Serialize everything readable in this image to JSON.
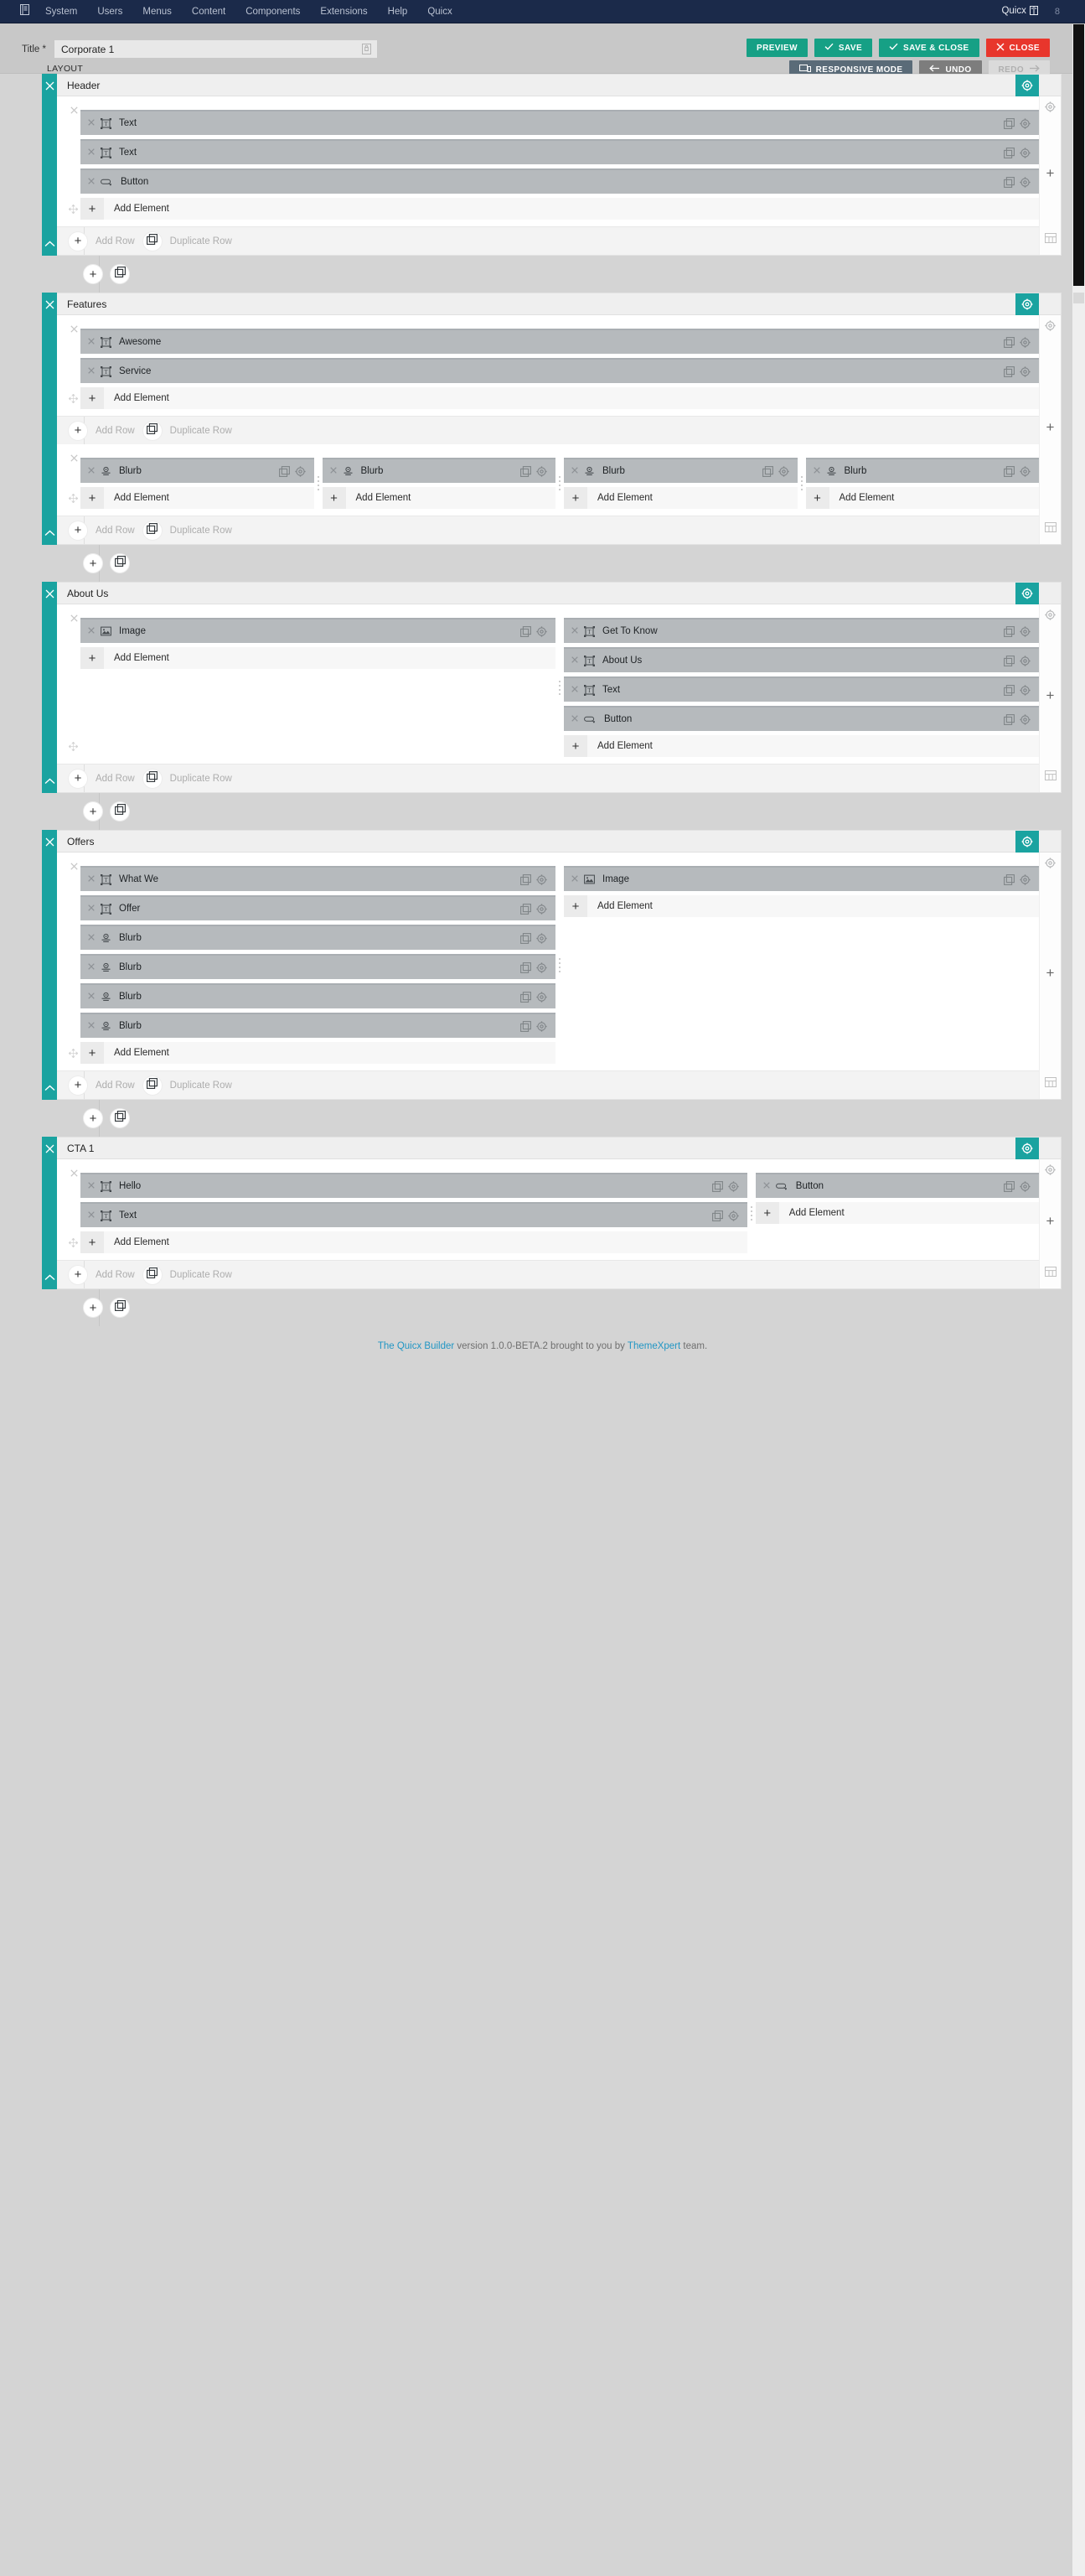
{
  "admin_bar": {
    "logo_icon": "joomla-menu-icon",
    "items": [
      "System",
      "Users",
      "Menus",
      "Content",
      "Components",
      "Extensions",
      "Help",
      "Quicx"
    ],
    "brand": "Quicx",
    "brand_icon": "book-icon",
    "user_badge": "8"
  },
  "toolbar": {
    "title_label": "Title *",
    "title_value": "Corporate 1",
    "title_icon": "lock-icon",
    "tab_layout": "LAYOUT",
    "preview": "PREVIEW",
    "save": "SAVE",
    "save_close": "SAVE & CLOSE",
    "close": "CLOSE",
    "responsive_mode": "RESPONSIVE MODE",
    "undo": "UNDO",
    "redo": "REDO",
    "colors": {
      "green": "#16a085",
      "red": "#e8362c",
      "slate": "#5a6b78",
      "gray": "#7d7d7d",
      "teal_rail": "#1aa3a0",
      "admin_bar": "#1b2a4a"
    }
  },
  "labels": {
    "add_element": "Add Element",
    "add_row": "Add Row",
    "duplicate_row": "Duplicate Row"
  },
  "sections": [
    {
      "title": "Header",
      "rows": [
        {
          "columns": [
            {
              "width": 100,
              "elements": [
                {
                  "label": "Text",
                  "icon": "text-element-icon"
                },
                {
                  "label": "Text",
                  "icon": "text-element-icon"
                },
                {
                  "label": "Button",
                  "icon": "button-element-icon"
                }
              ]
            }
          ]
        }
      ]
    },
    {
      "title": "Features",
      "rows": [
        {
          "columns": [
            {
              "width": 100,
              "elements": [
                {
                  "label": "Awesome",
                  "icon": "text-element-icon"
                },
                {
                  "label": "Service",
                  "icon": "text-element-icon"
                }
              ]
            }
          ]
        },
        {
          "columns": [
            {
              "width": 25,
              "elements": [
                {
                  "label": "Blurb",
                  "icon": "blurb-element-icon"
                }
              ]
            },
            {
              "width": 25,
              "elements": [
                {
                  "label": "Blurb",
                  "icon": "blurb-element-icon"
                }
              ]
            },
            {
              "width": 25,
              "elements": [
                {
                  "label": "Blurb",
                  "icon": "blurb-element-icon"
                }
              ]
            },
            {
              "width": 25,
              "elements": [
                {
                  "label": "Blurb",
                  "icon": "blurb-element-icon"
                }
              ]
            }
          ]
        }
      ]
    },
    {
      "title": "About Us",
      "rows": [
        {
          "columns": [
            {
              "width": 50,
              "elements": [
                {
                  "label": "Image",
                  "icon": "image-element-icon"
                }
              ]
            },
            {
              "width": 50,
              "elements": [
                {
                  "label": "Get To Know",
                  "icon": "text-element-icon"
                },
                {
                  "label": "About Us",
                  "icon": "text-element-icon"
                },
                {
                  "label": "Text",
                  "icon": "text-element-icon"
                },
                {
                  "label": "Button",
                  "icon": "button-element-icon"
                }
              ]
            }
          ]
        }
      ]
    },
    {
      "title": "Offers",
      "rows": [
        {
          "columns": [
            {
              "width": 50,
              "elements": [
                {
                  "label": "What We",
                  "icon": "text-element-icon"
                },
                {
                  "label": "Offer",
                  "icon": "text-element-icon"
                },
                {
                  "label": "Blurb",
                  "icon": "blurb-element-icon"
                },
                {
                  "label": "Blurb",
                  "icon": "blurb-element-icon"
                },
                {
                  "label": "Blurb",
                  "icon": "blurb-element-icon"
                },
                {
                  "label": "Blurb",
                  "icon": "blurb-element-icon"
                }
              ]
            },
            {
              "width": 50,
              "elements": [
                {
                  "label": "Image",
                  "icon": "image-element-icon"
                }
              ]
            }
          ]
        }
      ]
    },
    {
      "title": "CTA 1",
      "rows": [
        {
          "columns": [
            {
              "width": 70,
              "elements": [
                {
                  "label": "Hello",
                  "icon": "text-element-icon"
                },
                {
                  "label": "Text",
                  "icon": "text-element-icon"
                }
              ]
            },
            {
              "width": 30,
              "elements": [
                {
                  "label": "Button",
                  "icon": "button-element-icon"
                }
              ]
            }
          ]
        }
      ]
    }
  ],
  "footer": {
    "link1": "The Quicx Builder",
    "mid": " version 1.0.0-BETA.2 brought to you by ",
    "link2": "ThemeXpert",
    "end": " team."
  }
}
